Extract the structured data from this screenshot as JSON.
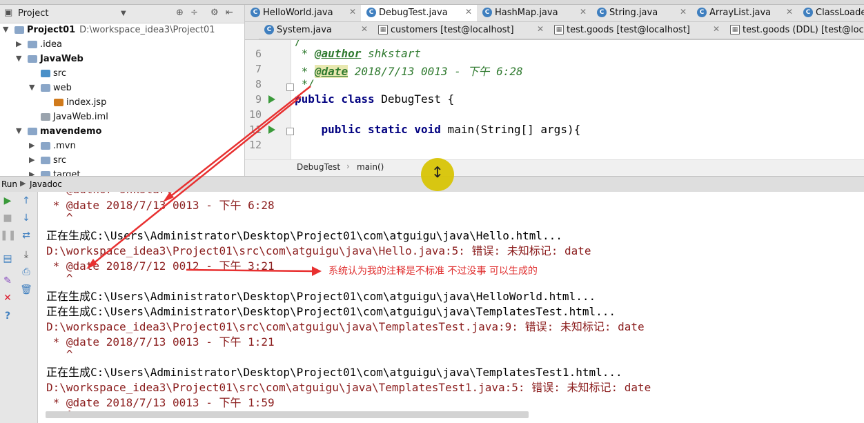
{
  "project_panel": {
    "title": "Project",
    "tree": [
      {
        "label": "Project01",
        "path": "D:\\workspace_idea3\\Project01",
        "bold": true,
        "depth": 0,
        "arrow": "▼",
        "icon": "folder"
      },
      {
        "label": ".idea",
        "depth": 1,
        "arrow": "▶",
        "icon": "folder"
      },
      {
        "label": "JavaWeb",
        "bold": true,
        "depth": 1,
        "arrow": "▼",
        "icon": "folder"
      },
      {
        "label": "src",
        "depth": 2,
        "arrow": "",
        "icon": "src-folder"
      },
      {
        "label": "web",
        "depth": 2,
        "arrow": "▼",
        "icon": "folder"
      },
      {
        "label": "index.jsp",
        "depth": 3,
        "arrow": "",
        "icon": "jsp"
      },
      {
        "label": "JavaWeb.iml",
        "depth": 2,
        "arrow": "",
        "icon": "iml"
      },
      {
        "label": "mavendemo",
        "bold": true,
        "depth": 1,
        "arrow": "▼",
        "icon": "folder"
      },
      {
        "label": ".mvn",
        "depth": 2,
        "arrow": "▶",
        "icon": "folder"
      },
      {
        "label": "src",
        "depth": 2,
        "arrow": "▶",
        "icon": "folder"
      },
      {
        "label": "target",
        "depth": 2,
        "arrow": "▶",
        "icon": "folder"
      }
    ]
  },
  "tabs_row1": [
    {
      "label": "HelloWorld.java",
      "active": false
    },
    {
      "label": "DebugTest.java",
      "active": true
    },
    {
      "label": "HashMap.java",
      "active": false
    },
    {
      "label": "String.java",
      "active": false
    },
    {
      "label": "ArrayList.java",
      "active": false
    },
    {
      "label": "ClassLoade",
      "active": false
    }
  ],
  "tabs_row2": [
    {
      "label": "System.java",
      "kind": "java"
    },
    {
      "label": "customers [test@localhost]",
      "kind": "db"
    },
    {
      "label": "test.goods [test@localhost]",
      "kind": "db"
    },
    {
      "label": "test.goods (DDL) [test@localh",
      "kind": "db"
    }
  ],
  "editor": {
    "lines": [
      {
        "n": "6",
        "html": "<span class=\"doc\"> * </span><span class=\"doctag\">@author</span><span class=\"doc\"> shkstart</span>"
      },
      {
        "n": "7",
        "html": "<span class=\"doc\"> * </span><span class=\"doctag hl\">@date</span><span class=\"doc\"> 2018/7/13 0013 - 下午 6:28</span>"
      },
      {
        "n": "8",
        "html": "<span class=\"doc\"> */</span>"
      },
      {
        "n": "9",
        "html": "<span class=\"kw\">public class</span> DebugTest {"
      },
      {
        "n": "10",
        "html": ""
      },
      {
        "n": "11",
        "html": "    <span class=\"kw\">public static void</span> main(String[] args){"
      },
      {
        "n": "12",
        "html": ""
      }
    ]
  },
  "breadcrumb": {
    "class": "DebugTest",
    "method": "main()"
  },
  "run_bar": {
    "run_label": "Run",
    "config": "Javadoc"
  },
  "console": {
    "lines": [
      {
        "t": " * @date 2018/7/13 0013 - 下午 6:28",
        "c": "red"
      },
      {
        "t": "   ^",
        "c": "red"
      },
      {
        "t": "正在生成C:\\Users\\Administrator\\Desktop\\Project01\\com\\atguigu\\java\\Hello.html...",
        "c": "black"
      },
      {
        "t": "D:\\workspace_idea3\\Project01\\src\\com\\atguigu\\java\\Hello.java:5: 错误: 未知标记: date",
        "c": "red"
      },
      {
        "t": " * @date 2018/7/12 0012 - 下午 3:21",
        "c": "red"
      },
      {
        "t": "   ^",
        "c": "red"
      },
      {
        "t": "正在生成C:\\Users\\Administrator\\Desktop\\Project01\\com\\atguigu\\java\\HelloWorld.html...",
        "c": "black"
      },
      {
        "t": "正在生成C:\\Users\\Administrator\\Desktop\\Project01\\com\\atguigu\\java\\TemplatesTest.html...",
        "c": "black"
      },
      {
        "t": "D:\\workspace_idea3\\Project01\\src\\com\\atguigu\\java\\TemplatesTest.java:9: 错误: 未知标记: date",
        "c": "red"
      },
      {
        "t": " * @date 2018/7/13 0013 - 下午 1:21",
        "c": "red"
      },
      {
        "t": "   ^",
        "c": "red"
      },
      {
        "t": "正在生成C:\\Users\\Administrator\\Desktop\\Project01\\com\\atguigu\\java\\TemplatesTest1.html...",
        "c": "black"
      },
      {
        "t": "D:\\workspace_idea3\\Project01\\src\\com\\atguigu\\java\\TemplatesTest1.java:5: 错误: 未知标记: date",
        "c": "red"
      },
      {
        "t": " * @date 2018/7/13 0013 - 下午 1:59",
        "c": "red"
      },
      {
        "t": "   ^",
        "c": "red"
      }
    ]
  },
  "annotation": {
    "text": "系统认为我的注释是不标准     不过没事    可以生成的",
    "color": "#e03030"
  },
  "colors": {
    "accent": "#3f7fbf",
    "error_text": "#8b1d1d",
    "doc_comment": "#2f7a2f",
    "keyword": "#000080",
    "annotation_red": "#e03030"
  }
}
